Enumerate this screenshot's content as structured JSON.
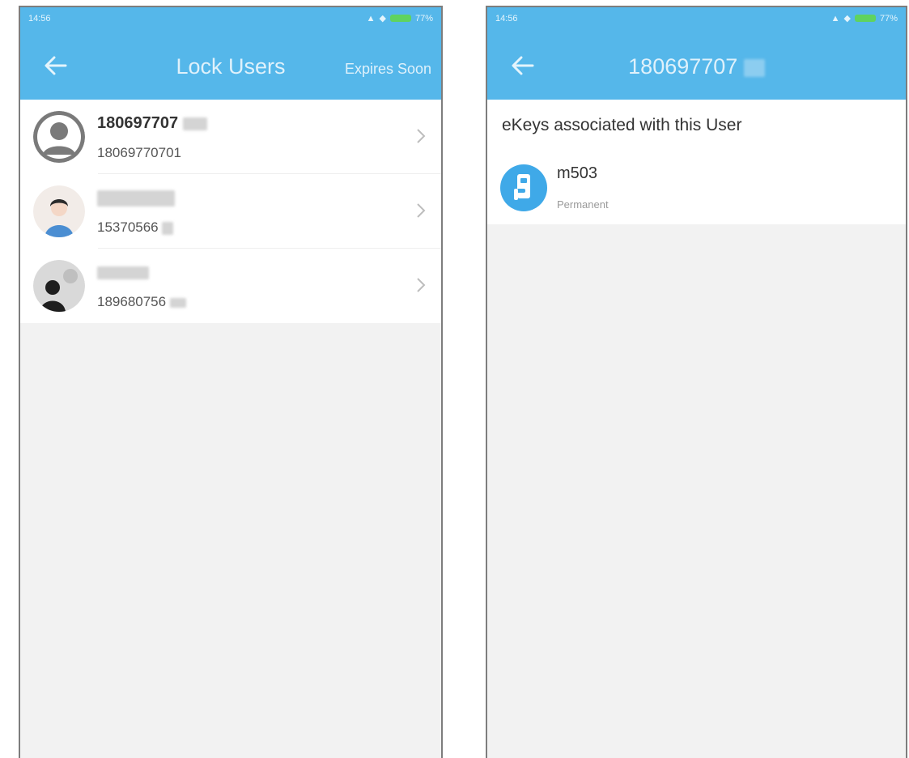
{
  "left_screen": {
    "status_bar": {
      "time": "14:56",
      "battery": "77%"
    },
    "header": {
      "title": "Lock Users",
      "action": "Expires Soon",
      "back_icon": "arrow-left-icon"
    },
    "users": [
      {
        "name": "180697707",
        "phone": "18069770701",
        "avatar": "default-avatar"
      },
      {
        "name": "",
        "phone": "15370566",
        "avatar": "photo-avatar"
      },
      {
        "name": "",
        "phone": "189680756",
        "avatar": "photo-avatar"
      }
    ]
  },
  "right_screen": {
    "status_bar": {
      "time": "14:56",
      "battery": "77%"
    },
    "header": {
      "title": "180697707",
      "back_icon": "arrow-left-icon"
    },
    "section_title": "eKeys associated with this User",
    "ekeys": [
      {
        "name": "m503",
        "validity": "Permanent",
        "icon": "lock-icon"
      }
    ]
  },
  "colors": {
    "accent": "#55b7ea",
    "background": "#f2f2f2",
    "row": "#ffffff"
  }
}
